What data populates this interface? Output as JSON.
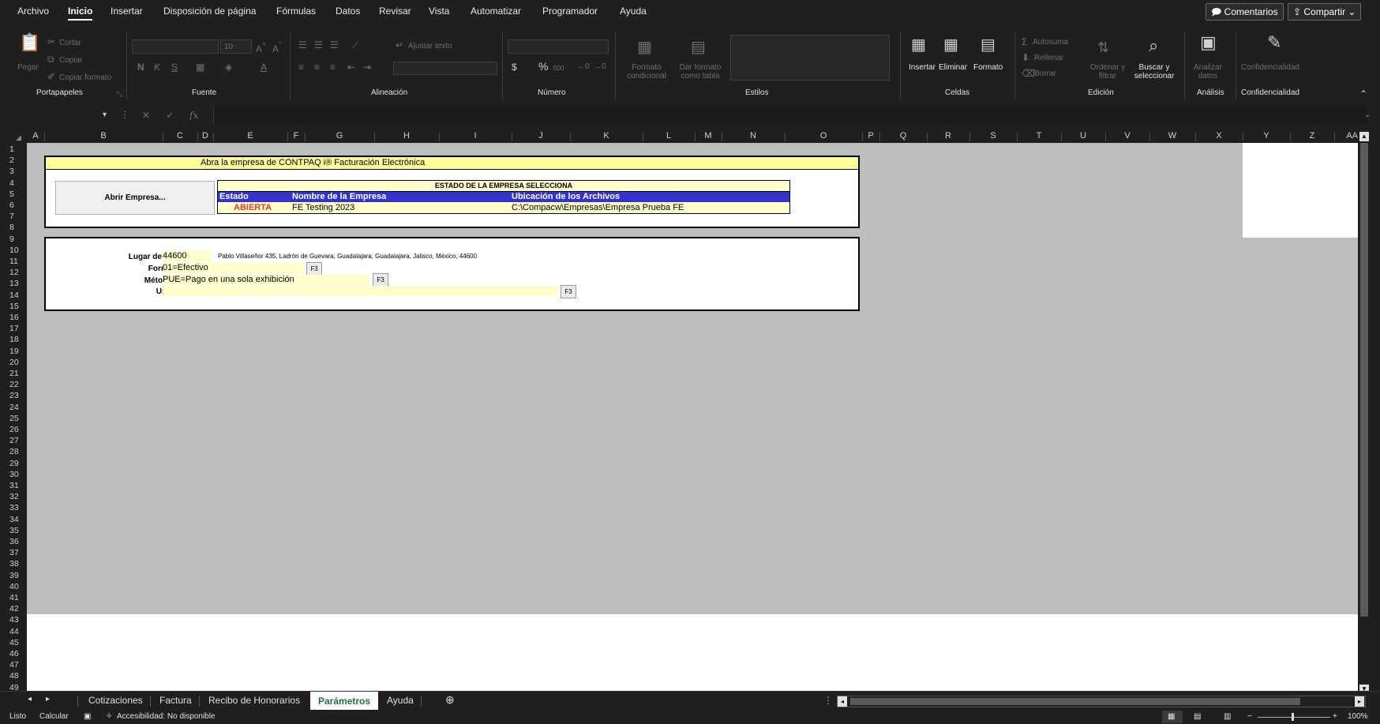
{
  "menu": {
    "tabs": [
      "Archivo",
      "Inicio",
      "Insertar",
      "Disposición de página",
      "Fórmulas",
      "Datos",
      "Revisar",
      "Vista",
      "Automatizar",
      "Programador",
      "Ayuda"
    ],
    "active": "Inicio",
    "comments": "Comentarios",
    "share": "Compartir"
  },
  "ribbon": {
    "clipboard": {
      "paste": "Pegar",
      "cut": "Cortar",
      "copy": "Copiar",
      "format_painter": "Copiar formato",
      "group": "Portapapeles"
    },
    "font": {
      "size": "10",
      "bold": "N",
      "italic": "K",
      "underline": "S",
      "group": "Fuente"
    },
    "alignment": {
      "wrap": "Ajustar texto",
      "group": "Alineación"
    },
    "number": {
      "currency": "$",
      "percent": "%",
      "thousands": "000",
      "group": "Número"
    },
    "styles": {
      "conditional": "Formato condicional",
      "table": "Dar formato como tabla",
      "group": "Estilos"
    },
    "cells": {
      "insert": "Insertar",
      "delete": "Eliminar",
      "format": "Formato",
      "group": "Celdas"
    },
    "editing": {
      "autosum": "Autosuma",
      "fill": "Rellenar",
      "clear": "Borrar",
      "sort": "Ordenar y filtrar",
      "find": "Buscar y seleccionar",
      "group": "Edición"
    },
    "analysis": {
      "analyze": "Analizar datos",
      "group": "Análisis"
    },
    "sensitivity": {
      "label": "Confidencialidad",
      "group": "Confidencialidad"
    }
  },
  "formula_bar": {
    "fx": "fx",
    "name_box": "",
    "content": ""
  },
  "columns": [
    "A",
    "B",
    "C",
    "D",
    "E",
    "F",
    "G",
    "H",
    "I",
    "J",
    "K",
    "L",
    "M",
    "N",
    "O",
    "P",
    "Q",
    "R",
    "S",
    "T",
    "U",
    "V",
    "W",
    "X",
    "Y",
    "Z",
    "AA"
  ],
  "rows": [
    "1",
    "2",
    "3",
    "4",
    "5",
    "6",
    "7",
    "8",
    "9",
    "10",
    "11",
    "12",
    "13",
    "14",
    "15",
    "16",
    "17",
    "18",
    "19",
    "20",
    "21",
    "22",
    "23",
    "24",
    "25",
    "26",
    "27",
    "28",
    "29",
    "30",
    "31",
    "32",
    "33",
    "34",
    "35",
    "36",
    "37",
    "38",
    "39",
    "40",
    "41",
    "42",
    "43",
    "44",
    "45",
    "46",
    "47",
    "48",
    "49"
  ],
  "sheet": {
    "banner": "Abra la empresa de CONTPAQ i® Facturación Electrónica",
    "open_button": "Abrir Empresa...",
    "status_title": "ESTADO DE LA EMPRESA SELECCIONA",
    "headers": {
      "state": "Estado",
      "company": "Nombre de la Empresa",
      "location": "Ubicación de los Archivos"
    },
    "values": {
      "state": "ABIERTA",
      "company": "FE Testing 2023",
      "location": "C:\\Compacw\\Empresas\\Empresa Prueba FE"
    },
    "params": {
      "lugar_label": "Lugar de expedición",
      "lugar_value": "44600",
      "lugar_address": "Pablo Villaseñor 435, Ladrón de Guevara, Guadalajara, Guadalajara, Jalisco, México, 44600",
      "forma_label": "Forma de Pago",
      "forma_value": "01=Efectivo",
      "metodo_label": "Método de Pago",
      "metodo_value": "PUE=Pago en una sola exhibición",
      "uso_label": "Uso del CFDI",
      "uso_value": "",
      "f3": "F3"
    }
  },
  "sheet_tabs": [
    "Cotizaciones",
    "Factura",
    "Recibo de Honorarios",
    "Parámetros",
    "Ayuda"
  ],
  "active_sheet": "Parámetros",
  "status": {
    "ready": "Listo",
    "calculate": "Calcular",
    "accessibility": "Accesibilidad: No disponible",
    "zoom": "100%"
  },
  "colors": {
    "banner_bg": "#ffff99",
    "header_blue": "#3333cc",
    "state_red": "#e03c31",
    "cell_yellow": "#ffffcc",
    "active_tab_green": "#1e7145"
  }
}
